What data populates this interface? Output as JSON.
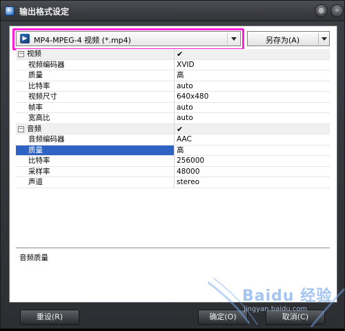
{
  "window": {
    "title": "输出格式设定",
    "close_glyph": "⊗",
    "min_glyph": "–"
  },
  "format": {
    "selected": "MP4-MPEG-4 视频 (*.mp4)",
    "icon": "film-icon",
    "highlight_color": "#ff1fd8"
  },
  "save_as": {
    "label": "另存为(A)"
  },
  "properties": {
    "video_group": {
      "label": "视频",
      "checked": "✔"
    },
    "video_rows": [
      {
        "name": "视频编码器",
        "value": "XVID"
      },
      {
        "name": "质量",
        "value": "高"
      },
      {
        "name": "比特率",
        "value": "auto"
      },
      {
        "name": "视频尺寸",
        "value": "640x480"
      },
      {
        "name": "帧率",
        "value": "auto"
      },
      {
        "name": "宽高比",
        "value": "auto"
      }
    ],
    "audio_group": {
      "label": "音频",
      "checked": "✔"
    },
    "audio_rows": [
      {
        "name": "音频编码器",
        "value": "AAC"
      },
      {
        "name": "质量",
        "value": "高"
      },
      {
        "name": "比特率",
        "value": "256000"
      },
      {
        "name": "采样率",
        "value": "48000"
      },
      {
        "name": "声道",
        "value": "stereo"
      }
    ],
    "toggle_glyph": "−",
    "selection_color": "#2f63c3"
  },
  "description": {
    "text": "音频质量"
  },
  "buttons": {
    "reset": "重设(R)",
    "ok": "确定(O)",
    "cancel": "取消(C)"
  },
  "watermark": {
    "brand": "Baidu 经验",
    "url": "jingyan.baidu.com"
  }
}
